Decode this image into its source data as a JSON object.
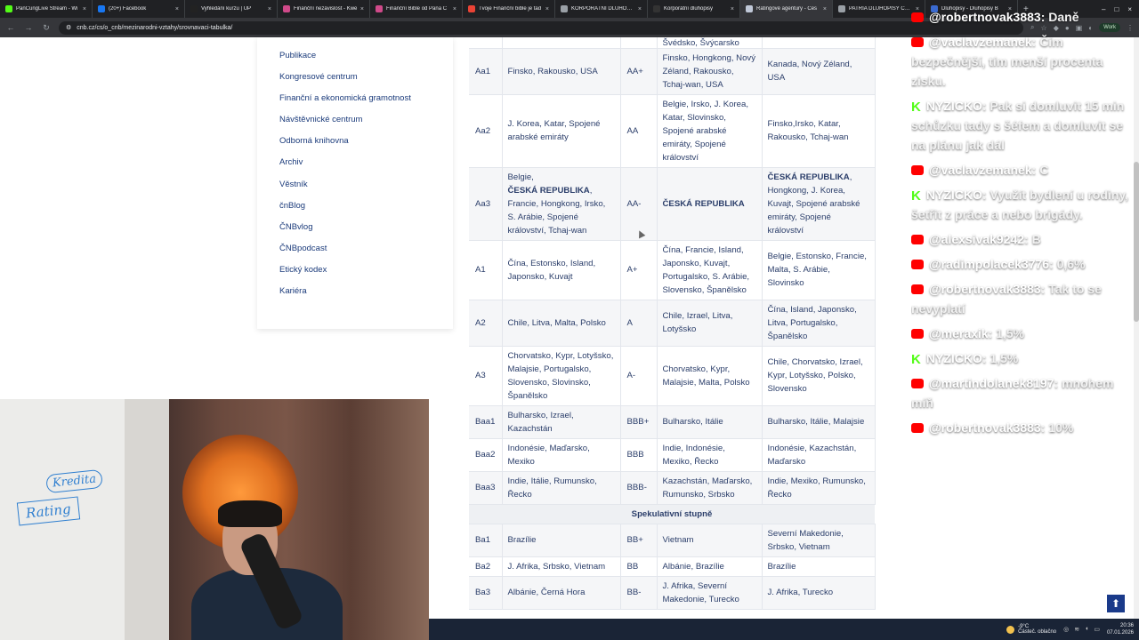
{
  "browser": {
    "tabs": [
      {
        "label": "PanCungLive Stream - Wi",
        "color": "#53fc18",
        "active": false
      },
      {
        "label": "(20+) Facebook",
        "color": "#1877f2",
        "active": false
      },
      {
        "label": "Vyhledání kurzu | ÚP",
        "color": "#222222",
        "active": false
      },
      {
        "label": "Finanční nezávislost - Kwe",
        "color": "#d04a8a",
        "active": false
      },
      {
        "label": "Finanční Bible od Pana Č",
        "color": "#d04a8a",
        "active": false
      },
      {
        "label": "Tvoje Finanční bible je tad",
        "color": "#ea4335",
        "active": false
      },
      {
        "label": "KORPORÁTNÍ DLUHOPISY",
        "color": "#9aa0a6",
        "active": false
      },
      {
        "label": "Korporátní dluhopisy",
        "color": "#333333",
        "active": false
      },
      {
        "label": "Ratingové agentury - Čes",
        "color": "#c0c8d8",
        "active": true
      },
      {
        "label": "PATRIA DLUHOPISY CESK",
        "color": "#9aa0a6",
        "active": false
      },
      {
        "label": "Dluhopisy - Dluhopisy B",
        "color": "#3a6ad0",
        "active": false
      }
    ],
    "url": "cnb.cz/cs/o_cnb/mezinarodni-vztahy/srovnavaci-tabulka/",
    "work_label": "Work"
  },
  "sidebar": {
    "items": [
      "Publikace",
      "Kongresové centrum",
      "Finanční a ekonomická gramotnost",
      "Návštěvnické centrum",
      "Odborná knihovna",
      "Archiv",
      "Věstník",
      "čnBlog",
      "ČNBvlog",
      "ČNBpodcast",
      "Etický kodex",
      "Kariéra"
    ]
  },
  "table": {
    "top_partial": {
      "c3": "Švédsko, Švýcarsko"
    },
    "rows": [
      {
        "c1": "Aa1",
        "c2": "Finsko, Rakousko, USA",
        "c3": "AA+",
        "c4": "Finsko, Hongkong, Nový Zéland, Rakousko, Tchaj-wan, USA",
        "c5": "Kanada, Nový Zéland, USA"
      },
      {
        "c1": "Aa2",
        "c2": "J. Korea, Katar, Spojené arabské emiráty",
        "c3": "AA",
        "c4": "Belgie, Irsko, J. Korea, Katar, Slovinsko, Spojené arabské emiráty, Spojené království",
        "c5": "Finsko,Irsko, Katar, Rakousko, Tchaj-wan"
      },
      {
        "c1": "Aa3",
        "c2a": "Belgie,",
        "c2b": "ČESKÁ REPUBLIKA",
        "c2c": ", Francie, Hongkong, Irsko, S. Arábie, Spojené království, Tchaj-wan",
        "c3": "AA-",
        "c4": "ČESKÁ REPUBLIKA",
        "c5a": "ČESKÁ REPUBLIKA",
        "c5b": ", Hongkong, J. Korea, Kuvajt, Spojené arabské emiráty, Spojené království"
      },
      {
        "c1": "A1",
        "c2": "Čína, Estonsko, Island, Japonsko, Kuvajt",
        "c3": "A+",
        "c4": "Čína, Francie, Island, Japonsko, Kuvajt, Portugalsko, S. Arábie, Slovensko, Španělsko",
        "c5": "Belgie, Estonsko, Francie, Malta, S. Arábie, Slovinsko"
      },
      {
        "c1": "A2",
        "c2": "Chile, Litva, Malta, Polsko",
        "c3": "A",
        "c4": "Chile, Izrael, Litva, Lotyšsko",
        "c5": "Čína, Island, Japonsko, Litva, Portugalsko, Španělsko"
      },
      {
        "c1": "A3",
        "c2": "Chorvatsko, Kypr, Lotyšsko, Malajsie, Portugalsko, Slovensko, Slovinsko, Španělsko",
        "c3": "A-",
        "c4": "Chorvatsko, Kypr, Malajsie, Malta, Polsko",
        "c5": "Chile, Chorvatsko, Izrael, Kypr, Lotyšsko, Polsko, Slovensko"
      },
      {
        "c1": "Baa1",
        "c2": "Bulharsko, Izrael, Kazachstán",
        "c3": "BBB+",
        "c4": "Bulharsko, Itálie",
        "c5": "Bulharsko, Itálie, Malajsie"
      },
      {
        "c1": "Baa2",
        "c2": "Indonésie, Maďarsko, Mexiko",
        "c3": "BBB",
        "c4": "Indie, Indonésie, Mexiko, Řecko",
        "c5": "Indonésie, Kazachstán, Maďarsko"
      },
      {
        "c1": "Baa3",
        "c2": "Indie, Itálie, Rumunsko, Řecko",
        "c3": "BBB-",
        "c4": "Kazachstán, Maďarsko, Rumunsko, Srbsko",
        "c5": "Indie, Mexiko, Rumunsko, Řecko"
      }
    ],
    "section_label": "Spekulativní stupně",
    "spec_rows": [
      {
        "c1": "Ba1",
        "c2": "Brazílie",
        "c3": "BB+",
        "c4": "Vietnam",
        "c5": "Severní Makedonie, Srbsko, Vietnam"
      },
      {
        "c1": "Ba2",
        "c2": "J. Afrika, Srbsko, Vietnam",
        "c3": "BB",
        "c4": "Albánie, Brazílie",
        "c5": "Brazílie"
      },
      {
        "c1": "Ba3",
        "c2": "Albánie, Černá Hora",
        "c3": "BB-",
        "c4": "J. Afrika, Severní Makedonie, Turecko",
        "c5": "J. Afrika, Turecko"
      }
    ]
  },
  "chat": {
    "messages": [
      {
        "source": "yt",
        "user": "@robertnovak3883",
        "text": "Daně"
      },
      {
        "source": "yt",
        "user": "@vaclavzemanek",
        "text": "Čím bezpečnější, tím menší procenta zisku."
      },
      {
        "source": "kick",
        "user": "NYZICKO",
        "text": "Pak si domluvit 15 min schůzku tady s šéfem a domluvit se na plánu jak dál"
      },
      {
        "source": "yt",
        "user": "@vaclavzemanek",
        "text": "C"
      },
      {
        "source": "kick",
        "user": "NYZICKO",
        "text": "Využít bydlení u rodiny, šetřit z práce a nebo brigády."
      },
      {
        "source": "yt",
        "user": "@alexsivak9242",
        "text": "B"
      },
      {
        "source": "yt",
        "user": "@radimpolacek3776",
        "text": "0,6%"
      },
      {
        "source": "yt",
        "user": "@robertnovak3883",
        "text": "Tak to se nevyplatí"
      },
      {
        "source": "yt",
        "user": "@meraxik",
        "text": "1,5%"
      },
      {
        "source": "kick",
        "user": "NYZICKO",
        "text": "1,5%"
      },
      {
        "source": "yt",
        "user": "@martindolanek8197",
        "text": "mnohem míň"
      },
      {
        "source": "yt",
        "user": "@robertnovak3883",
        "text": "10%"
      }
    ]
  },
  "webcam": {
    "whiteboard_text_1": "Kredita",
    "whiteboard_text_2": "Rating"
  },
  "taskbar": {
    "weather_temp": "-9°C",
    "weather_desc": "Částeč. oblačno",
    "time": "20:36",
    "date": "07.01.2026"
  }
}
